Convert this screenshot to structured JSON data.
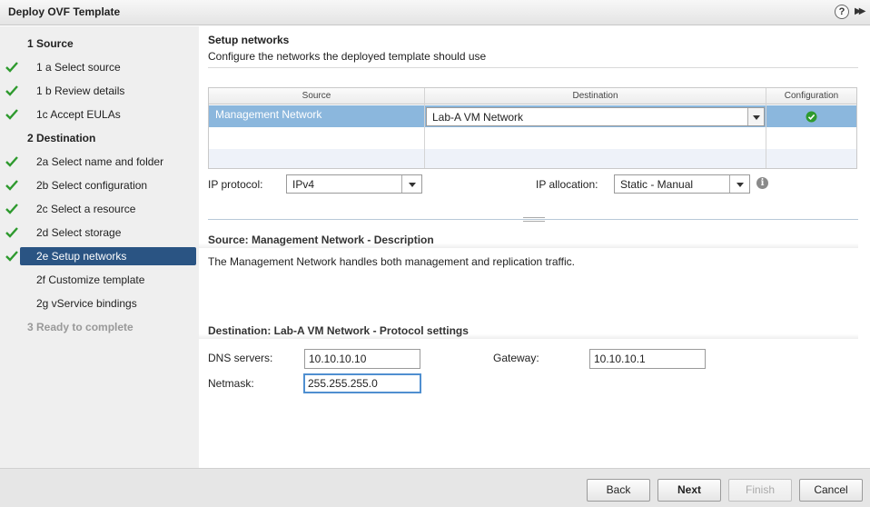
{
  "window": {
    "title": "Deploy OVF Template"
  },
  "colors": {
    "accent": "#2a5483",
    "selected_row": "#8bb7dd",
    "check_green": "#2e9a2e"
  },
  "steps": [
    {
      "label": "1  Source",
      "type": "group",
      "checked": false
    },
    {
      "label": "1 a  Select source",
      "type": "sub",
      "checked": true
    },
    {
      "label": "1 b  Review details",
      "type": "sub",
      "checked": true
    },
    {
      "label": "1c  Accept EULAs",
      "type": "sub",
      "checked": true
    },
    {
      "label": "2  Destination",
      "type": "group",
      "checked": false
    },
    {
      "label": "2a  Select name and folder",
      "type": "sub",
      "checked": true
    },
    {
      "label": "2b  Select configuration",
      "type": "sub",
      "checked": true
    },
    {
      "label": "2c  Select a resource",
      "type": "sub",
      "checked": true
    },
    {
      "label": "2d  Select storage",
      "type": "sub",
      "checked": true
    },
    {
      "label": "2e  Setup networks",
      "type": "sub",
      "checked": true,
      "active": true
    },
    {
      "label": "2f  Customize template",
      "type": "sub",
      "checked": false
    },
    {
      "label": "2g  vService bindings",
      "type": "sub",
      "checked": false
    },
    {
      "label": "3  Ready to complete",
      "type": "group",
      "checked": false,
      "disabled": true
    }
  ],
  "page": {
    "title": "Setup networks",
    "subtitle": "Configure the networks the deployed template should use"
  },
  "grid": {
    "headers": {
      "source": "Source",
      "destination": "Destination",
      "configuration": "Configuration"
    },
    "rows": [
      {
        "source": "Management Network",
        "destination": "Lab-A VM Network",
        "config_icon": "ok-check-icon"
      }
    ]
  },
  "ip_protocol": {
    "label": "IP protocol:",
    "value": "IPv4"
  },
  "ip_allocation": {
    "label": "IP allocation:",
    "value": "Static - Manual",
    "icon": "info-icon"
  },
  "source_section": {
    "title": "Source: Management Network - Description",
    "description": "The Management Network handles both management and replication traffic."
  },
  "dest_section": {
    "title": "Destination: Lab-A VM Network - Protocol settings",
    "dns_label": "DNS servers:",
    "dns_value": "10.10.10.10",
    "gateway_label": "Gateway:",
    "gateway_value": "10.10.10.1",
    "netmask_label": "Netmask:",
    "netmask_value": "255.255.255.0"
  },
  "buttons": {
    "back": "Back",
    "next": "Next",
    "finish": "Finish",
    "cancel": "Cancel"
  }
}
